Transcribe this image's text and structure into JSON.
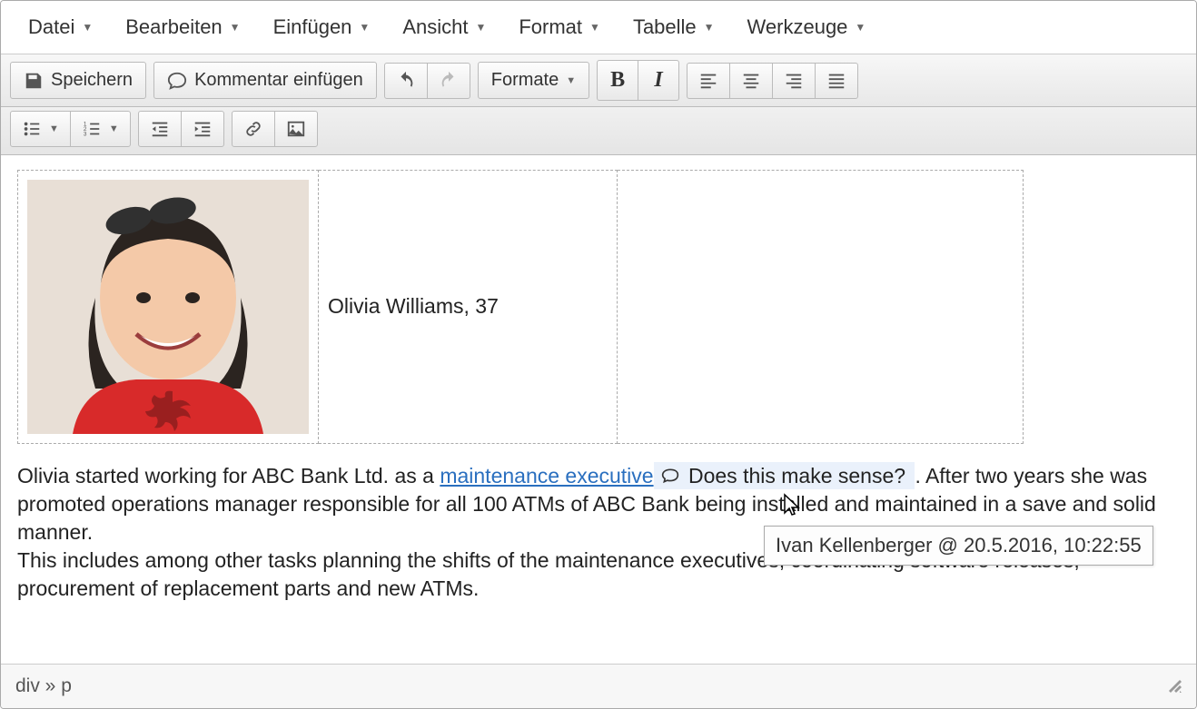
{
  "menubar": {
    "file": "Datei",
    "edit": "Bearbeiten",
    "insert": "Einfügen",
    "view": "Ansicht",
    "format": "Format",
    "table": "Tabelle",
    "tools": "Werkzeuge"
  },
  "toolbar": {
    "save_label": "Speichern",
    "comment_label": "Kommentar einfügen",
    "formats_label": "Formate"
  },
  "content": {
    "person_name": "Olivia Williams, 37",
    "para1_before": "Olivia started working for ABC Bank Ltd. as a ",
    "link_text": "maintenance executive",
    "comment_text": " Does this make sense? ",
    "para1_after": ". After two years she was promoted operations manager responsible for all 100 ATMs of ABC Bank being installed and maintained in a save and solid manner.",
    "para2": "This includes among other tasks planning the shifts of the maintenance executives, coordinating software releases, procurement of replacement parts and new ATMs."
  },
  "tooltip": {
    "text": "Ivan Kellenberger @ 20.5.2016, 10:22:55"
  },
  "statusbar": {
    "path": "div » p"
  }
}
